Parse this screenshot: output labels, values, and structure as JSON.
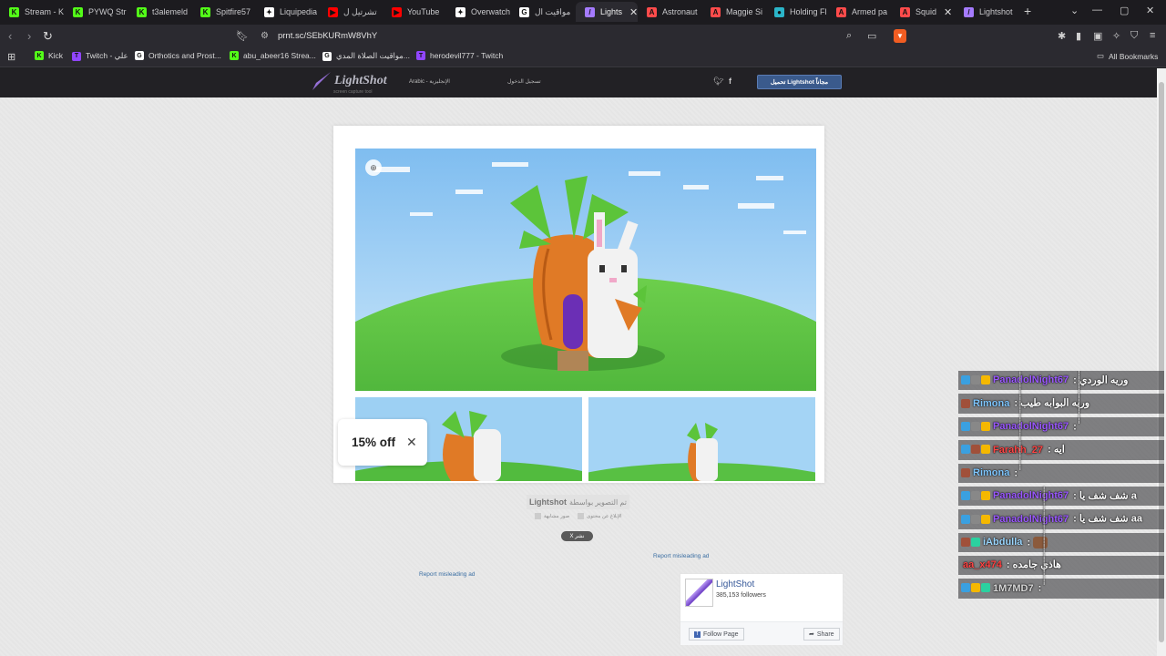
{
  "tabs": [
    {
      "label": "Stream - K",
      "fav": "K",
      "fav_color": "#53fc18"
    },
    {
      "label": "PYWQ Str",
      "fav": "K",
      "fav_color": "#53fc18"
    },
    {
      "label": "t3alemeld",
      "fav": "K",
      "fav_color": "#53fc18"
    },
    {
      "label": "Spitfire57",
      "fav": "K",
      "fav_color": "#53fc18"
    },
    {
      "label": "Liquipedia",
      "fav": "✦",
      "fav_color": "#ffffff"
    },
    {
      "label": "تشرتيل ل",
      "fav": "▶",
      "fav_color": "#ff0000"
    },
    {
      "label": "YouTube",
      "fav": "▶",
      "fav_color": "#ff0000"
    },
    {
      "label": "Overwatch",
      "fav": "✦",
      "fav_color": "#ffffff"
    },
    {
      "label": "مواقيت ال",
      "fav": "G",
      "fav_color": "#ffffff"
    },
    {
      "label": "Lights",
      "fav": "/",
      "fav_color": "#a57bff",
      "active": true
    },
    {
      "label": "Astronaut",
      "fav": "A",
      "fav_color": "#ff4b4b"
    },
    {
      "label": "Maggie Si",
      "fav": "A",
      "fav_color": "#ff4b4b"
    },
    {
      "label": "Holding Fl",
      "fav": "●",
      "fav_color": "#2bb5c9"
    },
    {
      "label": "Armed pa",
      "fav": "A",
      "fav_color": "#ff4b4b"
    },
    {
      "label": "Squid",
      "fav": "A",
      "fav_color": "#ff4b4b"
    },
    {
      "label": "Lightshot",
      "fav": "/",
      "fav_color": "#a57bff"
    }
  ],
  "address": {
    "url": "prnt.sc/SEbKURmW8VhY"
  },
  "bookmarks": [
    {
      "label": "Kick",
      "fav": "K",
      "fav_color": "#53fc18"
    },
    {
      "label": "Twitch - علي",
      "fav": "T",
      "fav_color": "#9146ff"
    },
    {
      "label": "Orthotics and Prost...",
      "fav": "G",
      "fav_color": "#ffffff"
    },
    {
      "label": "abu_abeer16 Strea...",
      "fav": "K",
      "fav_color": "#53fc18"
    },
    {
      "label": "مواقيت الصلاة المدي...",
      "fav": "G",
      "fav_color": "#ffffff"
    },
    {
      "label": "herodevil777 - Twitch",
      "fav": "T",
      "fav_color": "#9146ff"
    }
  ],
  "all_bookmarks": "All Bookmarks",
  "lightshot": {
    "logo": "LightShot",
    "tagline": "screen capture tool",
    "lang": "Arabic - الإنجليزية",
    "login": "تسجيل الدخول",
    "download": "تحميل Lightshot مجاناً",
    "promo": "15% off",
    "credit_prefix": "تم التصوير بواسطة",
    "credit_brand": "Lightshot",
    "opt_report": "الإبلاغ عن محتوى",
    "opt_similar": "صور مشابهة",
    "share_btn": "X نشر",
    "report_ad_1": "Report misleading ad",
    "report_ad_2": "Report misleading ad",
    "fb_title": "LightShot",
    "fb_followers": "385,153 followers",
    "fb_follow": "Follow Page",
    "fb_share": "Share"
  },
  "chat": [
    {
      "user": "PanadolNight67",
      "color": "#9b59ff",
      "sep": " : ",
      "text": "وريه الوردي",
      "badges": [
        "#3aa0e0",
        "#888",
        "#f5b800"
      ]
    },
    {
      "user": "Rimona",
      "color": "#7fc7ff",
      "sep": " : ",
      "text": "وريه البوابه طيب",
      "badges": [
        "#a0503a"
      ]
    },
    {
      "user": "PanadolNight67",
      "color": "#9b59ff",
      "sep": " : ",
      "text": "ٰٰٰٰٰٰٰٰٰٰٰٰٰٰٰٰٰٰٰٰٰٰٰٰٰٰٰٰٰٰٰٰٰٰٰٰٰٰٰٰٰٰٰٰٰٰٰٰٰٰٰٰٰٰٰٰٰٰٰٰٰ",
      "badges": [
        "#3aa0e0",
        "#888",
        "#f5b800"
      ]
    },
    {
      "user": "Farahh_27",
      "color": "#ff4444",
      "sep": " : ",
      "text": "ايه",
      "badges": [
        "#3aa0e0",
        "#a0503a",
        "#f5b800"
      ]
    },
    {
      "user": "Rimona",
      "color": "#7fc7ff",
      "sep": " : ",
      "text": "ٰٰٰٰٰٰٰٰٰٰٰٰٰٰٰٰٰٰٰٰٰٰٰٰٰٰٰٰٰٰٰٰٰٰٰٰٰٰٰٰٰٰٰٰٰٰٰٰٰٰٰٰٰٰٰٰٰٰٰٰٰٰٰٰٰٰٰٰٰٰٰٰٰٰٰٰٰٰٰٰٰٰٰٰٰٰ",
      "badges": [
        "#a0503a"
      ]
    },
    {
      "user": "PanadolNight67",
      "color": "#9b59ff",
      "sep": " : ",
      "text": "شف شف يا a",
      "badges": [
        "#3aa0e0",
        "#888",
        "#f5b800"
      ]
    },
    {
      "user": "PanadolNight67",
      "color": "#9b59ff",
      "sep": " : ",
      "text": "شف شف يا aa",
      "badges": [
        "#3aa0e0",
        "#888",
        "#f5b800"
      ]
    },
    {
      "user": "iAbdulla",
      "color": "#9bd7ff",
      "sep": " : ",
      "text": "",
      "emote": true,
      "badges": [
        "#a0503a",
        "#2bd1a0"
      ]
    },
    {
      "user": "aa_x474",
      "color": "#ff4444",
      "sep": " : ",
      "text": "هاذي جامده",
      "badges": []
    },
    {
      "user": "1M7MD7",
      "color": "#d8d8d8",
      "sep": " : ",
      "text": "ٰٰٰٰٰٰٰٰٰٰٰٰٰٰٰٰٰٰٰٰٰٰٰٰٰٰٰٰٰٰٰ",
      "badges": [
        "#3aa0e0",
        "#f5b800",
        "#2bd1a0"
      ]
    }
  ]
}
